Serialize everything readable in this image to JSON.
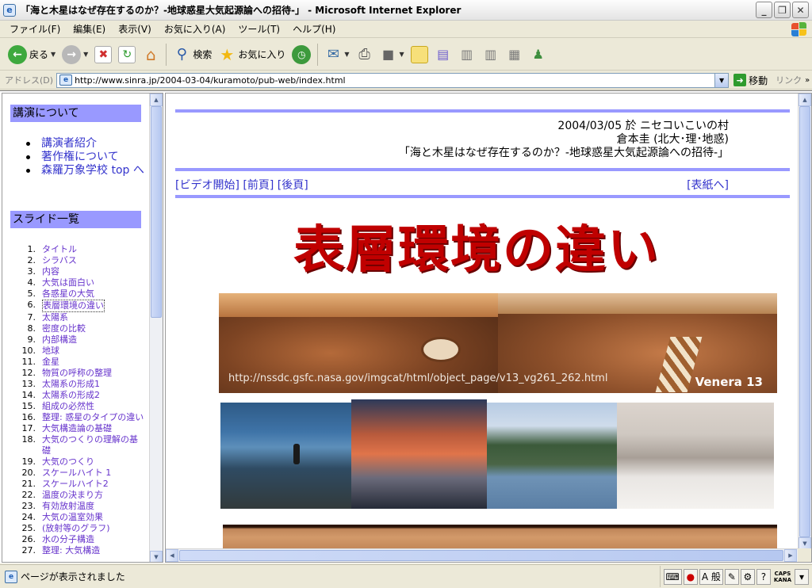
{
  "window": {
    "title": "「海と木星はなぜ存在するのか？-地球惑星大気起源論への招待-」 - Microsoft Internet Explorer",
    "app_icon": "e",
    "minimize": "_",
    "maximize": "❐",
    "close": "✕"
  },
  "menu": {
    "items": [
      "ファイル(F)",
      "編集(E)",
      "表示(V)",
      "お気に入り(A)",
      "ツール(T)",
      "ヘルプ(H)"
    ]
  },
  "toolbar": {
    "back_label": "戻る",
    "search_label": "検索",
    "favorites_label": "お気に入り",
    "icons": [
      "back-icon",
      "forward-icon",
      "stop-icon",
      "refresh-icon",
      "home-icon",
      "search-icon",
      "favorites-star-icon",
      "history-icon",
      "mail-icon",
      "print-icon",
      "edit-icon",
      "discuss-icon",
      "research-icon",
      "messenger-icon"
    ]
  },
  "address": {
    "label": "アドレス(D)",
    "url": "http://www.sinra.jp/2004-03-04/kuramoto/pub-web/index.html",
    "go_label": "移動",
    "links_label": "リンク"
  },
  "left_frame": {
    "talk_heading": "講演について",
    "talk_links": [
      "講演者紹介",
      "著作権について",
      "森羅万象学校 top へ"
    ],
    "slides_heading": "スライド一覧",
    "slides": [
      {
        "num": "1.",
        "label": "タイトル"
      },
      {
        "num": "2.",
        "label": "シラバス"
      },
      {
        "num": "3.",
        "label": "内容"
      },
      {
        "num": "4.",
        "label": "大気は面白い"
      },
      {
        "num": "5.",
        "label": "各惑星の大気"
      },
      {
        "num": "6.",
        "label": "表層環境の違い",
        "active": true
      },
      {
        "num": "7.",
        "label": "太陽系"
      },
      {
        "num": "8.",
        "label": "密度の比較"
      },
      {
        "num": "9.",
        "label": "内部構造"
      },
      {
        "num": "10.",
        "label": "地球"
      },
      {
        "num": "11.",
        "label": "金星"
      },
      {
        "num": "12.",
        "label": "物質の呼称の整理"
      },
      {
        "num": "13.",
        "label": "太陽系の形成1"
      },
      {
        "num": "14.",
        "label": "太陽系の形成2"
      },
      {
        "num": "15.",
        "label": "組成の必然性"
      },
      {
        "num": "16.",
        "label": "整理: 惑星のタイプの違い"
      },
      {
        "num": "17.",
        "label": "大気構造論の基礎"
      },
      {
        "num": "18.",
        "label": "大気のつくりの理解の基礎"
      },
      {
        "num": "19.",
        "label": "大気のつくり"
      },
      {
        "num": "20.",
        "label": "スケールハイト 1"
      },
      {
        "num": "21.",
        "label": "スケールハイト2"
      },
      {
        "num": "22.",
        "label": "温度の決まり方"
      },
      {
        "num": "23.",
        "label": "有効放射温度"
      },
      {
        "num": "24.",
        "label": "大気の温室効果"
      },
      {
        "num": "25.",
        "label": "(放射等のグラフ)"
      },
      {
        "num": "26.",
        "label": "水の分子構造"
      },
      {
        "num": "27.",
        "label": "整理: 大気構造"
      }
    ]
  },
  "right_frame": {
    "date_place": "2004/03/05 於 ニセコいこいの村",
    "author": "倉本圭 (北大･理･地惑)",
    "lecture_title": "「海と木星はなぜ存在するのか？-地球惑星大気起源論への招待-」",
    "nav": [
      "[ビデオ開始]",
      "[前頁]",
      "[後頁]"
    ],
    "cover_link": "[表紙へ]",
    "slide_title": "表層環境の違い",
    "image_source": "http://nssdc.gsfc.nasa.gov/imgcat/html/object_page/v13_vg261_262.html",
    "image_caption": "Venera 13"
  },
  "status": {
    "text": "ページが表示されました",
    "ime_mode": "A 般",
    "caps": "CAPS",
    "kana": "KANA"
  }
}
